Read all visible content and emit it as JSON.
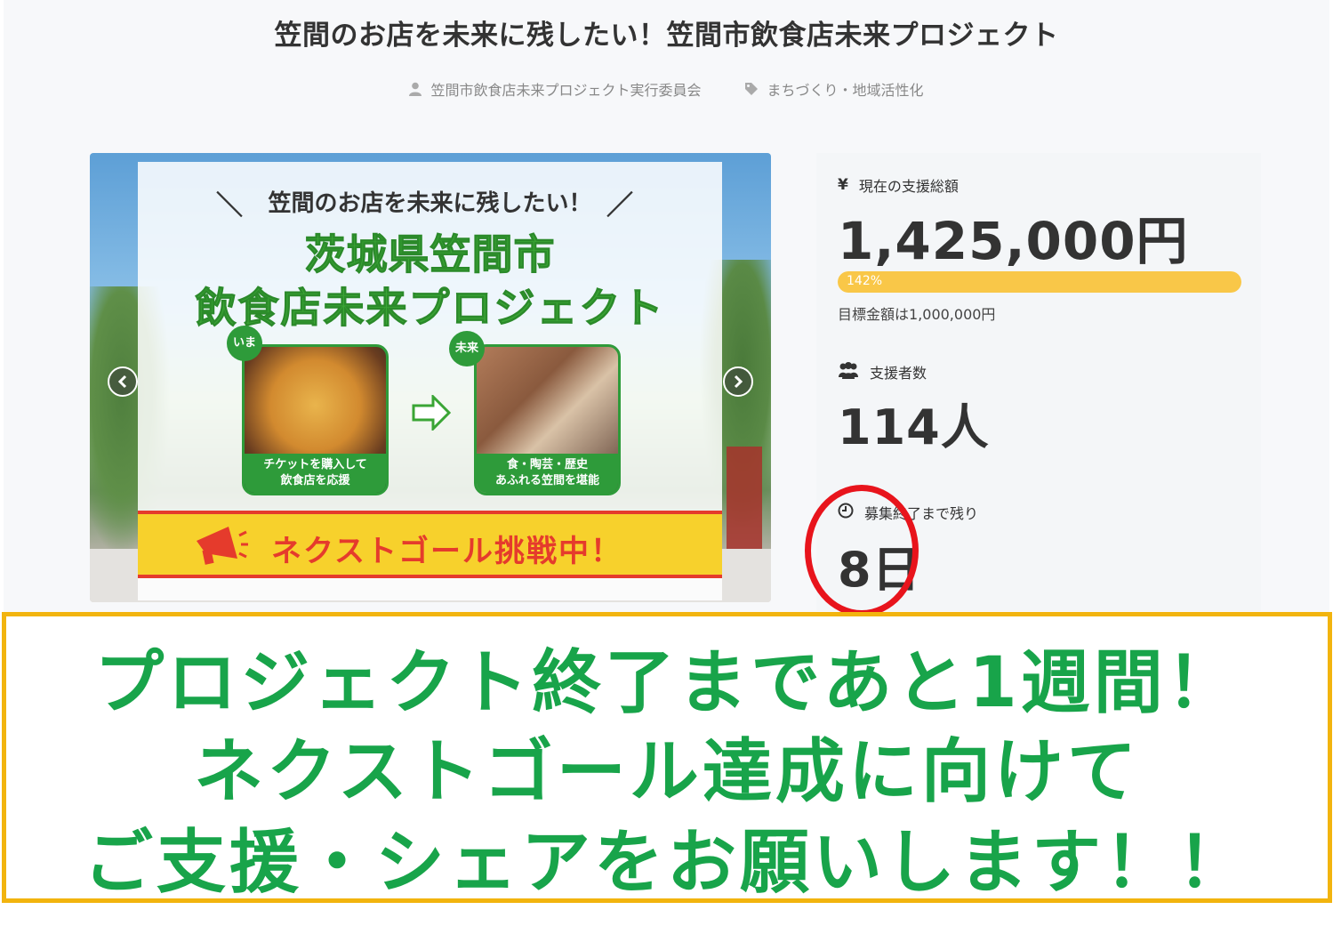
{
  "page": {
    "title": "笠間のお店を未来に残したい！笠間市飲食店未来プロジェクト",
    "owner": "笠間市飲食店未来プロジェクト実行委員会",
    "category": "まちづくり・地域活性化"
  },
  "banner": {
    "headline": "笠間のお店を未来に残したい！",
    "title_line1": "茨城県笠間市",
    "title_line2": "飲食店未来プロジェクト",
    "tag_now": "いま",
    "tag_future": "未来",
    "caption_now_1": "チケットを購入して",
    "caption_now_2": "飲食店を応援",
    "caption_future_1": "食・陶芸・歴史",
    "caption_future_2": "あふれる笠間を堪能",
    "next_goal": "ネクストゴール挑戦中！"
  },
  "stats": {
    "amount_icon": "¥",
    "amount_label": "現在の支援総額",
    "amount_value": "1,425,000円",
    "progress_label": "142%",
    "progress_fraction": 1.0,
    "goal_text": "目標金額は1,000,000円",
    "backers_label": "支援者数",
    "backers_value": "114人",
    "days_label": "募集終了まで残り",
    "days_value": "8日"
  },
  "callout": {
    "line1": "プロジェクト終了まであと1週間！",
    "line2": "ネクストゴール達成に向けて",
    "line3": "ご支援・シェアをお願いします！！"
  },
  "colors": {
    "progress": "#f9c748",
    "callout_text": "#18a44a",
    "callout_border": "#f2b40e",
    "highlight_circle": "#e8141c",
    "banner_green": "#3aa535"
  }
}
